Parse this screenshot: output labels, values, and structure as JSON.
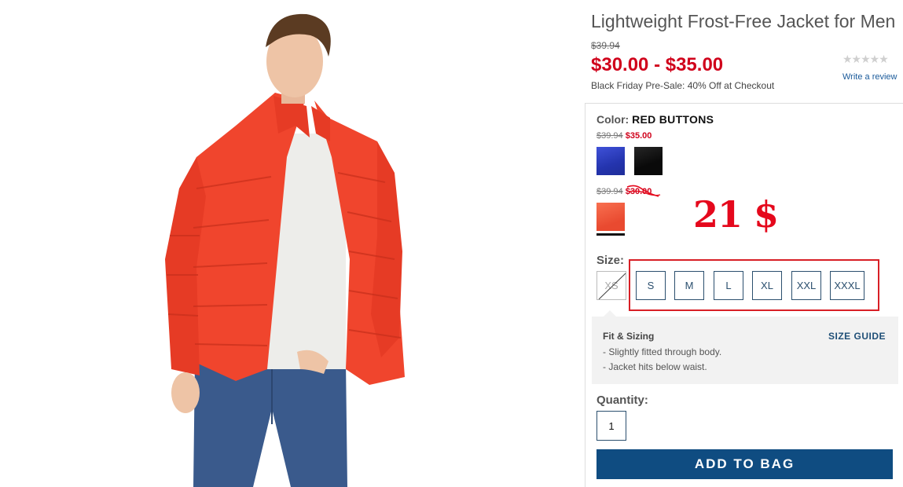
{
  "product": {
    "title": "Lightweight Frost-Free Jacket for Men",
    "original_price": "$39.94",
    "price_range": "$30.00 - $35.00",
    "promo": "Black Friday Pre-Sale: 40% Off at Checkout"
  },
  "reviews": {
    "stars": "★★★★★",
    "rating": 0,
    "write_review": "Write a review"
  },
  "color": {
    "label": "Color:",
    "selected": "RED BUTTONS",
    "groups": [
      {
        "old_price": "$39.94",
        "new_price": "$35.00",
        "swatches": [
          {
            "name": "blue",
            "hex": "#2b3dc2"
          },
          {
            "name": "black",
            "hex": "#0d0d0d"
          }
        ]
      },
      {
        "old_price": "$39.94",
        "new_price": "$30.00",
        "swatches": [
          {
            "name": "red",
            "hex": "#f05a40",
            "selected": true
          }
        ]
      }
    ]
  },
  "annotation": {
    "handwritten_price": "21 $",
    "color": "#e5081c",
    "box_color": "#d81f26"
  },
  "size": {
    "label": "Size:",
    "options": [
      {
        "label": "XS",
        "available": false
      },
      {
        "label": "S",
        "available": true
      },
      {
        "label": "M",
        "available": true
      },
      {
        "label": "L",
        "available": true
      },
      {
        "label": "XL",
        "available": true
      },
      {
        "label": "XXL",
        "available": true
      },
      {
        "label": "XXXL",
        "available": true
      }
    ]
  },
  "fit": {
    "title": "Fit & Sizing",
    "lines": [
      "- Slightly fitted through body.",
      "- Jacket hits below waist."
    ],
    "size_guide": "SIZE GUIDE"
  },
  "quantity": {
    "label": "Quantity:",
    "value": "1"
  },
  "cart": {
    "add_label": "ADD TO BAG",
    "button_color": "#0f4c81"
  }
}
